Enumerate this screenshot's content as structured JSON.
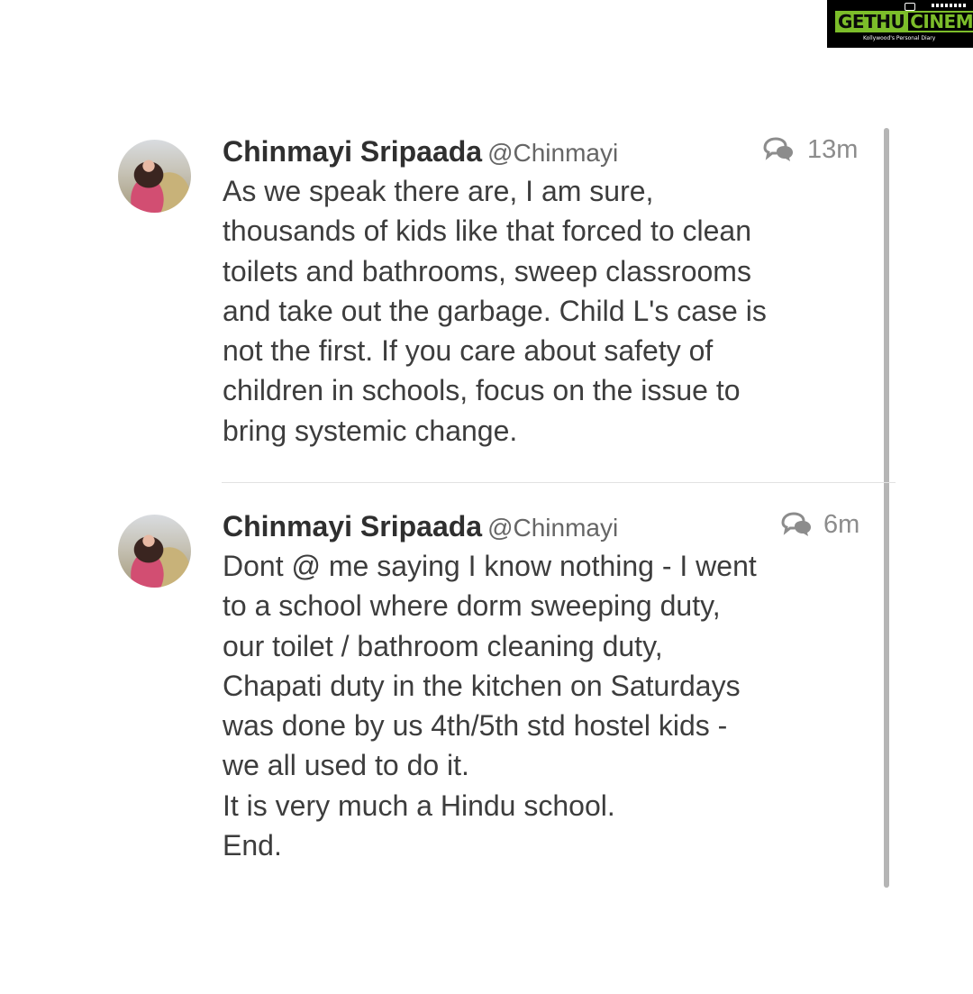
{
  "watermark": {
    "brand_part_a": "GETHU",
    "brand_part_b": "CINEMA",
    "tagline": "Kollywood's Personal Diary"
  },
  "tweets": [
    {
      "name": "Chinmayi Sripaada",
      "handle": "@Chinmayi",
      "time": "13m",
      "icon": "conversation-icon",
      "lines": [
        "As we speak there are, I am sure,",
        "thousands of kids like that forced to clean",
        "toilets and bathrooms, sweep classrooms",
        "and take out the garbage. Child L's case is",
        "not the first. If you care about safety of",
        "children in schools, focus on the issue to",
        "bring systemic change."
      ]
    },
    {
      "name": "Chinmayi Sripaada",
      "handle": "@Chinmayi",
      "time": "6m",
      "icon": "conversation-icon",
      "lines": [
        "Dont @ me saying I know nothing - I went",
        "to a school where dorm sweeping duty,",
        "our toilet / bathroom cleaning duty,",
        "Chapati duty in the kitchen on Saturdays",
        "was done by us 4th/5th std hostel kids -",
        "we all used to do it.",
        "It is very much a Hindu school.",
        "End."
      ]
    }
  ]
}
